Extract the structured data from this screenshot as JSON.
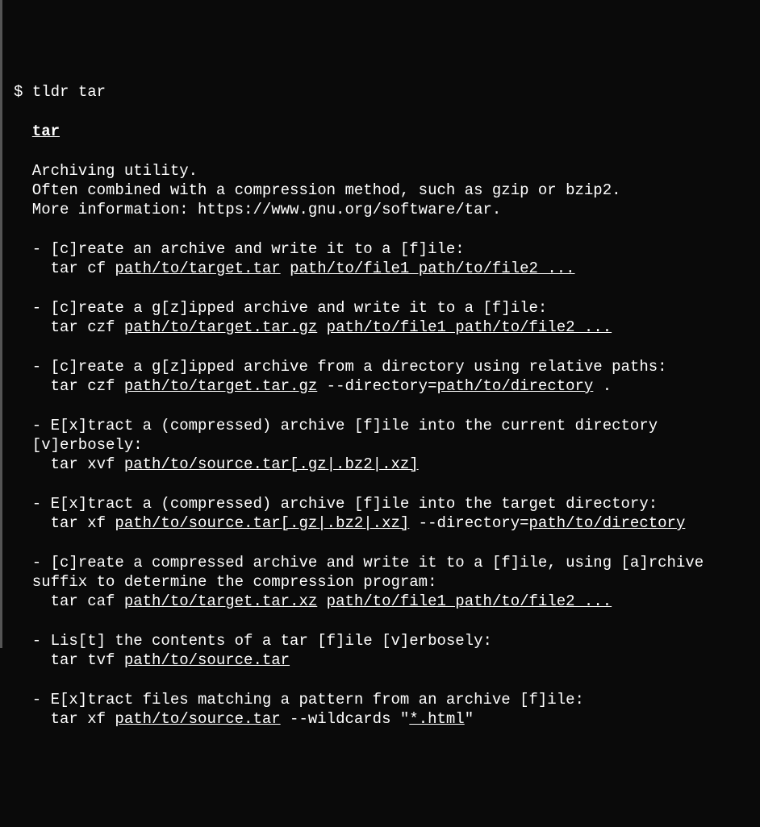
{
  "prompt": "$ ",
  "command": "tldr tar",
  "title": "tar",
  "description": [
    "Archiving utility.",
    "Often combined with a compression method, such as gzip or bzip2.",
    "More information: https://www.gnu.org/software/tar."
  ],
  "examples": [
    {
      "desc": "- [c]reate an archive and write it to a [f]ile:",
      "cmd_prefix": "tar cf ",
      "args": [
        {
          "text": "path/to/target.tar",
          "u": true
        },
        {
          "text": " ",
          "u": false
        },
        {
          "text": "path/to/file1 path/to/file2 ...",
          "u": true
        }
      ]
    },
    {
      "desc": "- [c]reate a g[z]ipped archive and write it to a [f]ile:",
      "cmd_prefix": "tar czf ",
      "args": [
        {
          "text": "path/to/target.tar.gz",
          "u": true
        },
        {
          "text": " ",
          "u": false
        },
        {
          "text": "path/to/file1 path/to/file2 ...",
          "u": true
        }
      ]
    },
    {
      "desc": "- [c]reate a g[z]ipped archive from a directory using relative paths:",
      "cmd_prefix": "tar czf ",
      "args": [
        {
          "text": "path/to/target.tar.gz",
          "u": true
        },
        {
          "text": " --directory=",
          "u": false
        },
        {
          "text": "path/to/directory",
          "u": true
        },
        {
          "text": " .",
          "u": false
        }
      ]
    },
    {
      "desc": "- E[x]tract a (compressed) archive [f]ile into the current directory [v]erbosely:",
      "cmd_prefix": "tar xvf ",
      "args": [
        {
          "text": "path/to/source.tar[.gz|.bz2|.xz]",
          "u": true
        }
      ]
    },
    {
      "desc": "- E[x]tract a (compressed) archive [f]ile into the target directory:",
      "cmd_prefix": "tar xf ",
      "args": [
        {
          "text": "path/to/source.tar[.gz|.bz2|.xz]",
          "u": true
        },
        {
          "text": " --directory=",
          "u": false
        },
        {
          "text": "path/to/directory",
          "u": true
        }
      ]
    },
    {
      "desc": "- [c]reate a compressed archive and write it to a [f]ile, using [a]rchive suffix to determine the compression program:",
      "cmd_prefix": "tar caf ",
      "args": [
        {
          "text": "path/to/target.tar.xz",
          "u": true
        },
        {
          "text": " ",
          "u": false
        },
        {
          "text": "path/to/file1 path/to/file2 ...",
          "u": true
        }
      ]
    },
    {
      "desc": "- Lis[t] the contents of a tar [f]ile [v]erbosely:",
      "cmd_prefix": "tar tvf ",
      "args": [
        {
          "text": "path/to/source.tar",
          "u": true
        }
      ]
    },
    {
      "desc": "- E[x]tract files matching a pattern from an archive [f]ile:",
      "cmd_prefix": "tar xf ",
      "args": [
        {
          "text": "path/to/source.tar",
          "u": true
        },
        {
          "text": " --wildcards \"",
          "u": false
        },
        {
          "text": "*.html",
          "u": true
        },
        {
          "text": "\"",
          "u": false
        }
      ]
    }
  ]
}
